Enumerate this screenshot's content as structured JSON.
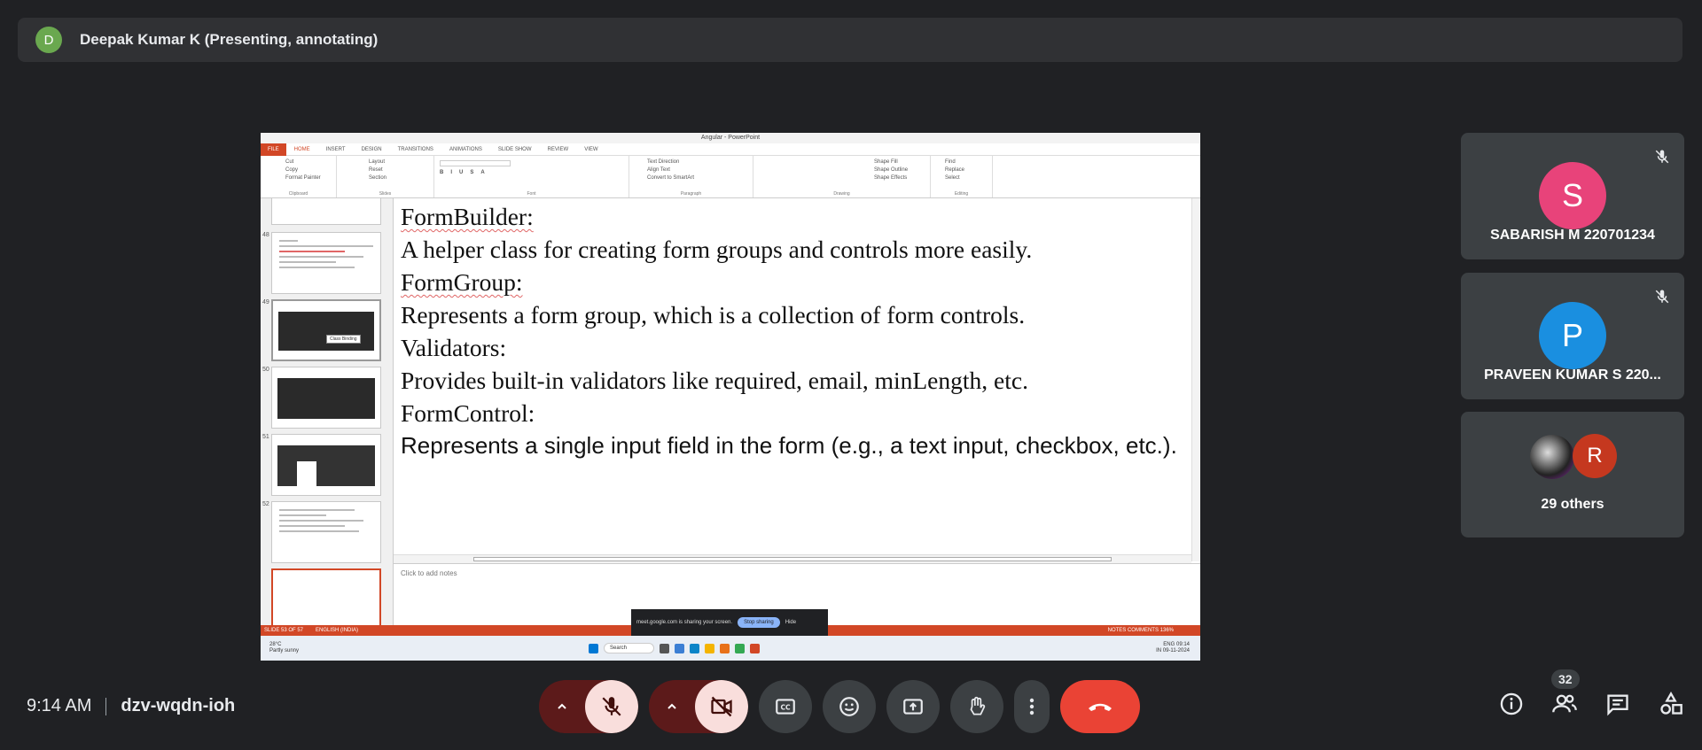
{
  "header": {
    "presenter_initial": "D",
    "presenter_label": "Deepak Kumar K (Presenting, annotating)",
    "avatar_color": "#6aa84f"
  },
  "shared_screen": {
    "window_title": "Angular - PowerPoint",
    "ribbon_tabs": [
      "FILE",
      "HOME",
      "INSERT",
      "DESIGN",
      "TRANSITIONS",
      "ANIMATIONS",
      "SLIDE SHOW",
      "REVIEW",
      "VIEW"
    ],
    "ribbon_groups": [
      {
        "label": "Clipboard",
        "items": [
          "Cut",
          "Copy",
          "Format Painter"
        ]
      },
      {
        "label": "Slides",
        "items": [
          "Layout",
          "Reset",
          "Section"
        ]
      },
      {
        "label": "Font",
        "items": []
      },
      {
        "label": "Paragraph",
        "items": [
          "Text Direction",
          "Align Text",
          "Convert to SmartArt"
        ]
      },
      {
        "label": "Drawing",
        "items": [
          "Shape Fill",
          "Shape Outline",
          "Shape Effects"
        ]
      },
      {
        "label": "Editing",
        "items": [
          "Find",
          "Replace",
          "Select"
        ]
      }
    ],
    "thumbnails": [
      {
        "number": "48"
      },
      {
        "number": "49"
      },
      {
        "number": "50"
      },
      {
        "number": "51"
      },
      {
        "number": "52"
      }
    ],
    "thumb_tooltip": "Class Binding",
    "slide_lines": [
      {
        "text": "FormBuilder:",
        "style": "hd"
      },
      {
        "text": "A helper class for creating form groups and controls more easily.",
        "style": ""
      },
      {
        "text": "FormGroup:",
        "style": "hd"
      },
      {
        "text": "Represents a form group, which is a collection of form controls.",
        "style": ""
      },
      {
        "text": "Validators:",
        "style": ""
      },
      {
        "text": "Provides built-in validators like required, email, minLength, etc.",
        "style": ""
      },
      {
        "text": "FormControl:",
        "style": ""
      },
      {
        "text": "Represents a single input field in the form (e.g., a text input, checkbox, etc.).",
        "style": "sans"
      }
    ],
    "notes_placeholder": "Click to add notes",
    "status_slide": "SLIDE 53 OF 57",
    "status_lang": "ENGLISH (INDIA)",
    "status_right": "NOTES   COMMENTS   136%",
    "share_banner": {
      "text": "meet.google.com is sharing your screen.",
      "stop": "Stop sharing",
      "hide": "Hide"
    },
    "taskbar": {
      "weather_temp": "28°C",
      "weather_desc": "Partly sunny",
      "search": "Search",
      "lang": "ENG",
      "region": "IN",
      "time": "09:14",
      "date": "09-11-2024"
    }
  },
  "participants": [
    {
      "initial": "S",
      "name": "SABARISH M 220701234",
      "color": "#e8437a"
    },
    {
      "initial": "P",
      "name": "PRAVEEN KUMAR S 220...",
      "color": "#1a8fe0"
    },
    {
      "initial": "R",
      "name": "29 others",
      "color": "#c5381f"
    }
  ],
  "footer": {
    "time": "9:14 AM",
    "meeting_code": "dzv-wqdn-ioh",
    "people_count": "32",
    "end_color": "#ea4335"
  }
}
